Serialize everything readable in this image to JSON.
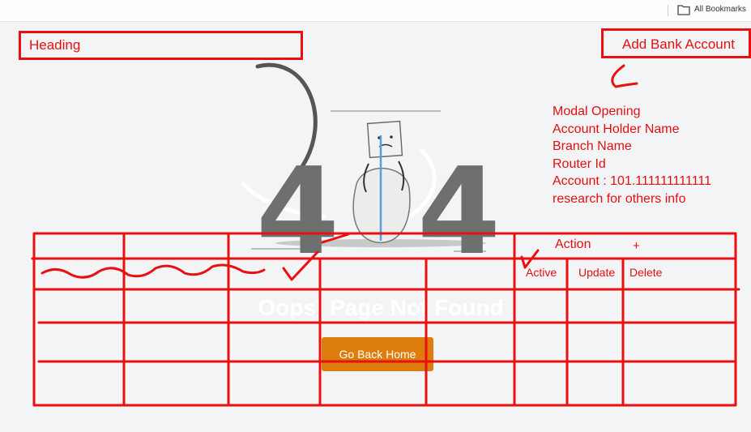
{
  "browser": {
    "bookmarks_label": "All Bookmarks",
    "bookmarks_icon": "folder-icon"
  },
  "error_page": {
    "code": "404",
    "message": "Oops! Page Not Found",
    "button_label": "Go Back Home",
    "button_color": "#dd7d0e"
  },
  "annotations": {
    "heading": "Heading",
    "add_bank_account": "Add Bank Account",
    "notes": [
      "Modal Opening",
      "Account Holder Name",
      "Branch Name",
      "Router Id",
      "Account : 101.111111111111",
      "research for others info"
    ],
    "table": {
      "action_header": "Action",
      "plus": "+",
      "actions": [
        "Active",
        "Update",
        "Delete"
      ]
    },
    "color": "#e81010"
  }
}
